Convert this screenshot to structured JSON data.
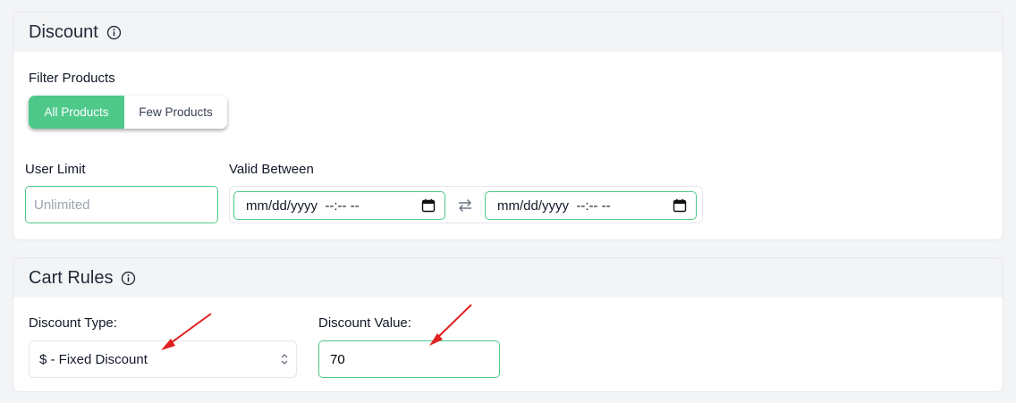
{
  "discount": {
    "title": "Discount",
    "filter_label": "Filter Products",
    "toggle": {
      "all": "All Products",
      "few": "Few Products",
      "selected": "all"
    },
    "user_limit_label": "User Limit",
    "user_limit_placeholder": "Unlimited",
    "valid_between_label": "Valid Between",
    "date_from": "mm/dd/yyyy  --:-- --",
    "date_to": "mm/dd/yyyy  --:-- --"
  },
  "cart_rules": {
    "title": "Cart Rules",
    "discount_type_label": "Discount Type:",
    "discount_type_value": "$ - Fixed Discount",
    "discount_value_label": "Discount Value:",
    "discount_value": "70"
  },
  "colors": {
    "accent": "#4ec98a",
    "annotation_arrow": "#e02020"
  }
}
